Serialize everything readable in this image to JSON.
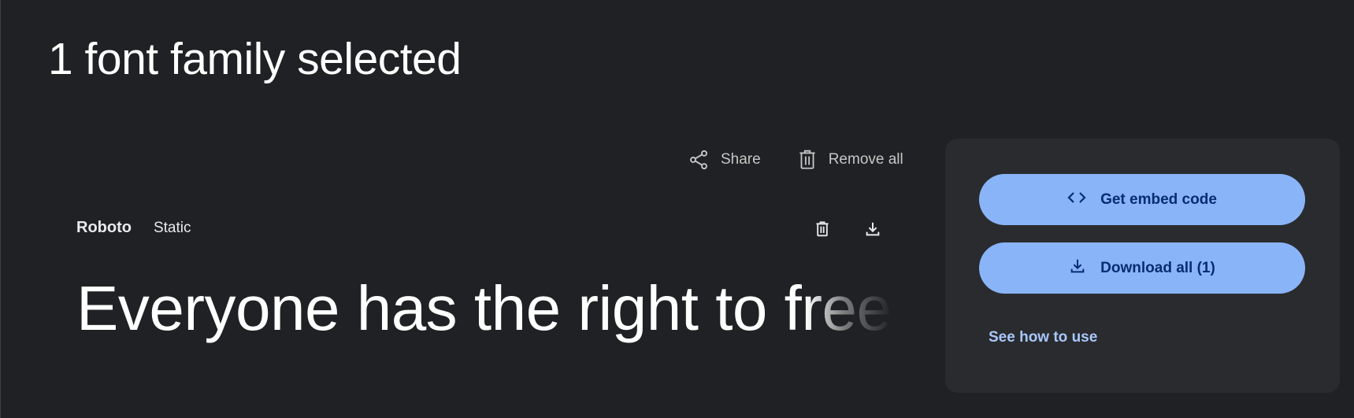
{
  "page": {
    "title": "1 font family selected"
  },
  "actions": {
    "share_label": "Share",
    "remove_all_label": "Remove all"
  },
  "family": {
    "name": "Roboto",
    "style": "Static",
    "sample_text": "Everyone has the right to freedom"
  },
  "panel": {
    "embed_label": "Get embed code",
    "download_label": "Download all (1)",
    "how_to_use_label": "See how to use"
  },
  "icons": {
    "share": "share-icon",
    "remove_all": "trash-icon",
    "family_remove": "trash-icon",
    "family_download": "download-icon",
    "embed": "code-brackets-icon",
    "download_all": "download-icon"
  },
  "colors": {
    "background": "#202124",
    "panel": "#2a2b2e",
    "primary_button": "#8ab4f8",
    "primary_button_text": "#062e6f",
    "link": "#a8c7fa"
  }
}
